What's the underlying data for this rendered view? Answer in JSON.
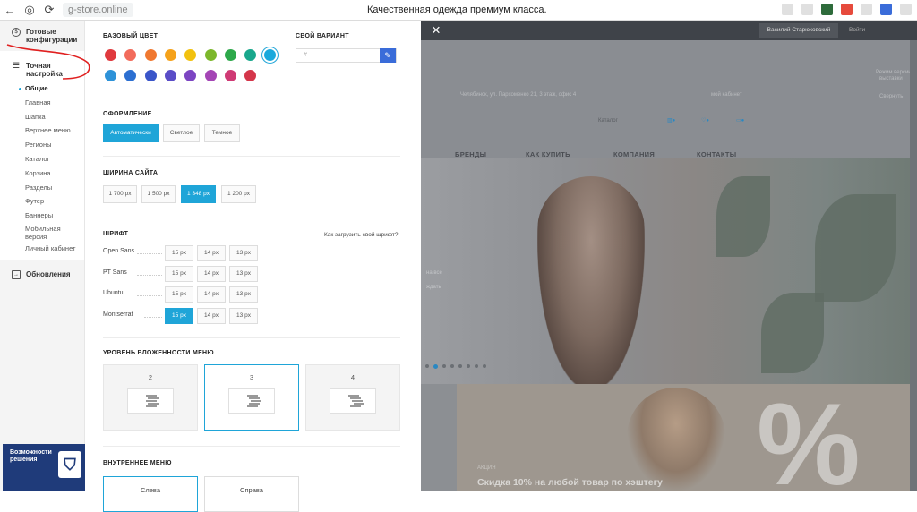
{
  "browser": {
    "back": "←",
    "reload": "⟳",
    "url": "g-store.online",
    "title": "Качественная одежда премиум класса."
  },
  "sidebar": {
    "items": [
      {
        "label": "Готовые конфигурации",
        "icon": "dollar-icon"
      },
      {
        "label": "Точная настройка",
        "icon": "sliders-icon"
      },
      {
        "label": "Обновления",
        "icon": "exit-icon"
      }
    ],
    "sub": [
      "Общие",
      "Главная",
      "Шапка",
      "Верхнее меню",
      "Регионы",
      "Каталог",
      "Корзина",
      "Разделы",
      "Футер",
      "Баннеры",
      "Мобильная версия",
      "Личный кабинет"
    ],
    "promo": {
      "line1": "Возможности",
      "line2": "решения"
    }
  },
  "settings": {
    "base_color": {
      "title": "БАЗОВЫЙ ЦВЕТ",
      "colors": [
        "#e03a3e",
        "#f26b5b",
        "#f07830",
        "#f5a21b",
        "#f2c10f",
        "#7cb72b",
        "#2da84a",
        "#19a78c",
        "#1aa9dc",
        "#2e92d8",
        "#2c6fd1",
        "#3a55c9",
        "#5a4dc7",
        "#7c45c2",
        "#a445b5",
        "#cf3a74",
        "#d4364a"
      ],
      "selected": "#1aa9dc"
    },
    "custom": {
      "title": "СВОЙ ВАРИАНТ",
      "value": "#"
    },
    "design": {
      "title": "ОФОРМЛЕНИЕ",
      "options": [
        "Автоматически",
        "Светлое",
        "Темное"
      ],
      "selected": "Автоматически"
    },
    "width": {
      "title": "ШИРИНА САЙТА",
      "options": [
        "1 700 px",
        "1 500 px",
        "1 348 px",
        "1 200 px"
      ],
      "selected": "1 348 px"
    },
    "font": {
      "title": "ШРИФТ",
      "help": "Как загрузить свой шрифт?",
      "rows": [
        {
          "name": "Open Sans",
          "sizes": [
            "15 px",
            "14 px",
            "13 px"
          ],
          "selected": null
        },
        {
          "name": "PT Sans",
          "sizes": [
            "15 px",
            "14 px",
            "13 px"
          ],
          "selected": null
        },
        {
          "name": "Ubuntu",
          "sizes": [
            "15 px",
            "14 px",
            "13 px"
          ],
          "selected": null
        },
        {
          "name": "Montserrat",
          "sizes": [
            "15 px",
            "14 px",
            "13 px"
          ],
          "selected": "15 px"
        }
      ]
    },
    "menu_level": {
      "title": "УРОВЕНЬ ВЛОЖЕННОСТИ МЕНЮ",
      "options": [
        "2",
        "3",
        "4"
      ],
      "selected": "3"
    },
    "inner_menu": {
      "title": "ВНУТРЕННЕЕ МЕНЮ",
      "options": [
        "Слева",
        "Справа"
      ],
      "selected": "Слева"
    }
  },
  "preview": {
    "close": "×",
    "user": "Василий Старюковский",
    "login": "Войти",
    "address": "Челябинск, ул. Пархоменко 21, 3 этаж, офис 4",
    "account": "мой кабинет",
    "catalog": "Каталог",
    "nav": [
      "БРЕНДЫ",
      "КАК КУПИТЬ",
      "КОМПАНИЯ",
      "КОНТАКТЫ"
    ],
    "side_text": [
      "Режим версии",
      "выставки",
      "Свернуть"
    ],
    "hero_text": [
      "на все",
      "ждать"
    ],
    "promo_tag": "АКЦИЯ",
    "promo_title": "Скидка 10% на любой товар по хэштегу",
    "percent": "%"
  }
}
